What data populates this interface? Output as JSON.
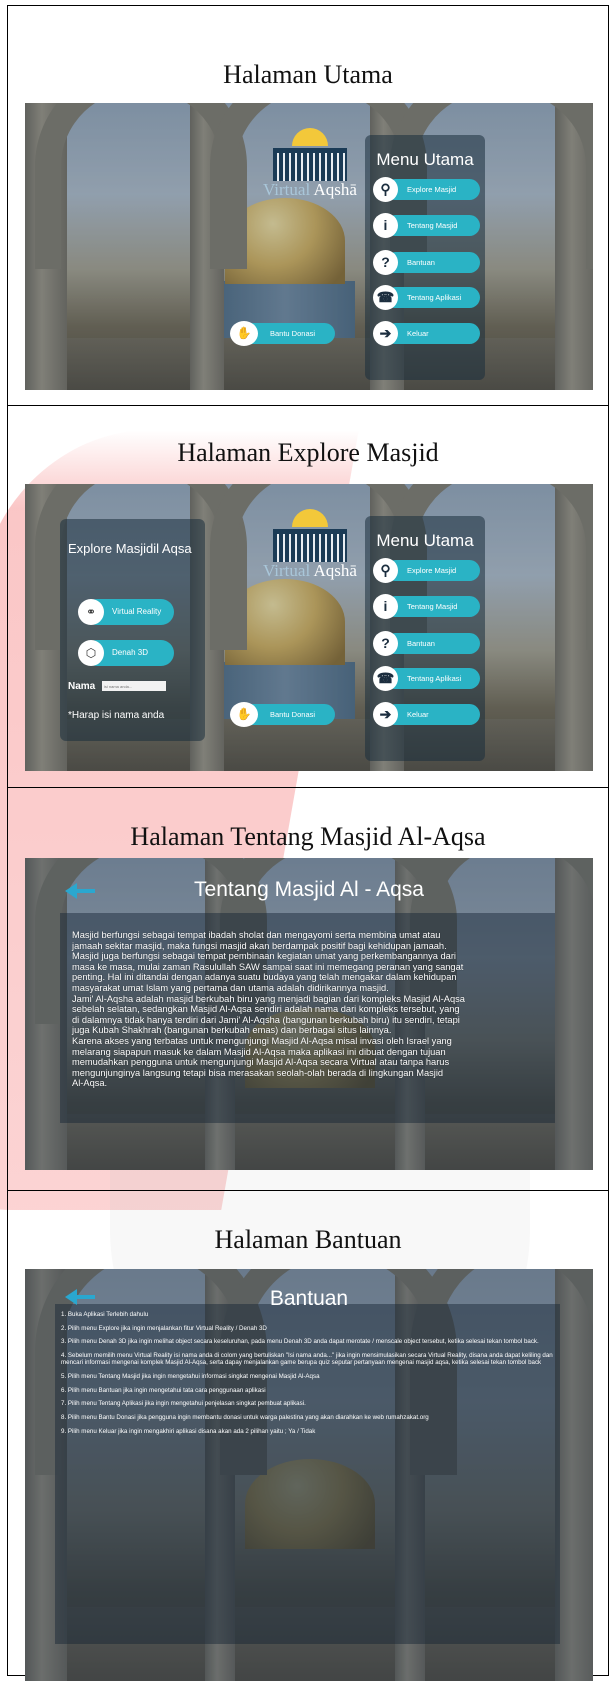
{
  "rows": [
    {
      "caption": "Halaman Utama"
    },
    {
      "caption": "Halaman Explore Masjid"
    },
    {
      "caption": "Halaman Tentang Masjid Al-Aqsa"
    },
    {
      "caption": "Halaman Bantuan"
    }
  ],
  "logo": {
    "virtual": "Virtual",
    "aqsha": "Aqshā"
  },
  "menu": {
    "title": "Menu Utama",
    "items": [
      {
        "label": "Explore Masjid",
        "icon": "search-icon"
      },
      {
        "label": "Tentang Masjid",
        "icon": "info-icon"
      },
      {
        "label": "Bantuan",
        "icon": "help-icon"
      },
      {
        "label": "Tentang Aplikasi",
        "icon": "phone-icon"
      },
      {
        "label": "Keluar",
        "icon": "exit-icon"
      }
    ]
  },
  "donasi": {
    "label": "Bantu Donasi",
    "icon": "handshake-icon"
  },
  "explore": {
    "title": "Explore Masjidil Aqsa",
    "vr_label": "Virtual Reality",
    "denah_label": "Denah 3D",
    "nama_label": "Nama",
    "nama_placeholder": "isi nama anda...",
    "harap": "*Harap isi nama anda"
  },
  "tentang": {
    "title": "Tentang Masjid Al - Aqsa",
    "lines": [
      "Masjid berfungsi sebagai tempat ibadah sholat dan mengayomi serta membina umat atau",
      "jamaah sekitar masjid, maka fungsi masjid akan berdampak positif bagi kehidupan jamaah.",
      "Masjid juga berfungsi sebagai tempat pembinaan kegiatan umat yang perkembangannya dari",
      "masa ke masa, mulai zaman Rasulullah SAW sampai saat ini memegang peranan yang sangat",
      "penting. Hal ini ditandai dengan adanya suatu budaya yang telah mengakar dalam kehidupan",
      "masyarakat umat Islam yang pertama dan utama adalah didirikannya masjid.",
      "Jami' Al-Aqsha adalah masjid berkubah biru yang menjadi bagian dari kompleks Masjid Al-Aqsa",
      "sebelah selatan, sedangkan Masjid Al-Aqsa sendiri adalah nama dari kompleks tersebut, yang",
      "di dalamnya tidak hanya terdiri dari Jami' Al-Aqsha (bangunan berkubah biru) itu sendiri, tetapi",
      "juga Kubah Shakhrah (bangunan berkubah emas) dan berbagai situs lainnya.",
      " Karena akses yang terbatas untuk mengunjungi Masjid Al-Aqsa misal invasi oleh Israel yang",
      "melarang siapapun masuk ke dalam Masjid Al-Aqsa maka aplikasi ini dibuat dengan tujuan",
      "memudahkan pengguna untuk mengunjungi Masjid Al-Aqsa secara Virtual atau tanpa harus",
      "mengunjunginya langsung tetapi bisa merasakan seolah-olah berada di lingkungan Masjid",
      "Al-Aqsa."
    ]
  },
  "bantuan": {
    "title": "Bantuan",
    "items": [
      "1. Buka Aplikasi Terlebih dahulu",
      "2. Pilih menu Explore jika ingin menjalankan fitur Virtual Reality / Denah 3D",
      "3. Pilih menu Denah 3D jika ingin melihat object secara keseluruhan, pada menu Denah 3D anda dapat merotate / menscale object tersebut, ketika selesai tekan tombol back.",
      "4. Sebelum memilih menu Virtual Reality isi nama anda di colom yang bertuliskan \"Isi nama anda...\" jika ingin mensimulasikan secara Virtual Reality, disana anda dapat keliling dan mencari informasi mengenai komplek Masjid Al-Aqsa, serta dapay menjalankan game berupa quiz seputar pertanyaan mengenai masjid aqsa, ketika selesai tekan tombol back",
      "5. Pilih menu Tentang Masjid jika ingin mengetahui informasi singkat mengenai Masjid Al-Aqsa",
      "6. Pilih menu Bantuan jika ingin mengetahui tata cara penggunaan aplikasi",
      "7. Pilih menu Tentang Aplikasi jika ingin mengetahui penjelasan singkat pembuat aplikasi.",
      "8. Pilih menu Bantu Donasi jika pengguna ingin membantu donasi untuk warga palestina yang akan diarahkan ke web rumahzakat.org",
      "9. Pilih menu Keluar jika ingin mengakhiri aplikasi disana akan ada 2 pilihan yaitu ; Ya / Tidak"
    ]
  },
  "colors": {
    "button": "#2ab3c5",
    "arrow": "#2aa7cf",
    "panel": "#192d3c"
  }
}
